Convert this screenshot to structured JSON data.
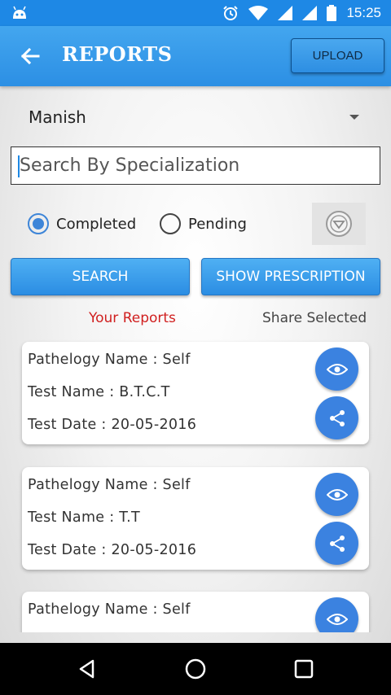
{
  "status_bar": {
    "time": "15:25"
  },
  "app_bar": {
    "title": "REPORTS",
    "upload_label": "UPLOAD"
  },
  "spinner": {
    "selected": "Manish"
  },
  "search": {
    "placeholder": "Search By Specialization"
  },
  "filters": {
    "completed_label": "Completed",
    "pending_label": "Pending",
    "selected": "Completed"
  },
  "buttons": {
    "search_label": "SEARCH",
    "show_prescription_label": "SHOW PRESCRIPTION"
  },
  "section": {
    "your_reports": "Your Reports",
    "share_selected": "Share Selected"
  },
  "reports": [
    {
      "pathology": "Pathelogy Name : Self",
      "test": "Test Name : B.T.C.T",
      "date": "Test Date : 20-05-2016"
    },
    {
      "pathology": "Pathelogy Name : Self",
      "test": "Test Name : T.T",
      "date": "Test Date : 20-05-2016"
    },
    {
      "pathology": "Pathelogy Name : Self",
      "test": "",
      "date": ""
    }
  ],
  "colors": {
    "primary": "#1e88e5",
    "fab": "#3b82e0",
    "accent_red": "#d01f1f"
  },
  "icons": [
    "android-icon",
    "alarm-icon",
    "wifi-icon",
    "signal-icon",
    "battery-icon",
    "back-arrow-icon",
    "filter-icon",
    "eye-icon",
    "share-icon",
    "nav-back-icon",
    "nav-home-icon",
    "nav-recents-icon"
  ]
}
